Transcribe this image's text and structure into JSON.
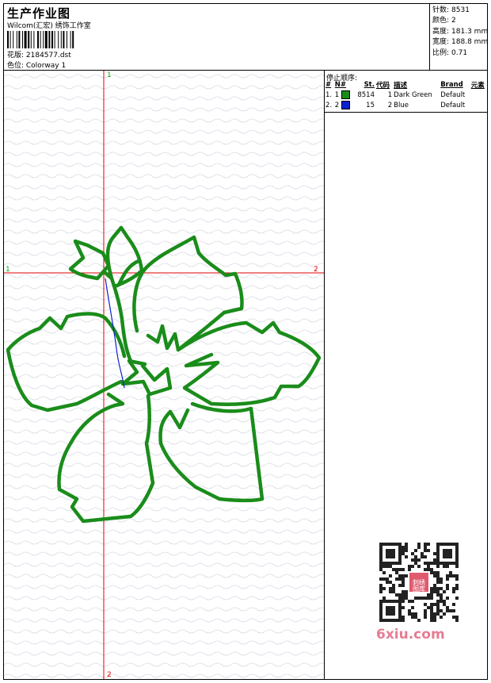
{
  "header": {
    "title": "生产作业图",
    "subtitle": "Wilcom(汇宏) 绣饰工作室",
    "design": "花版: 2184577.dst",
    "colorway": "色位: Colorway 1"
  },
  "stats": [
    {
      "label": "针数:",
      "value": "8531"
    },
    {
      "label": "颜色:",
      "value": "2"
    },
    {
      "label": "高度:",
      "value": "181.3 mm"
    },
    {
      "label": "宽度:",
      "value": "188.8 mm"
    },
    {
      "label": "比例:",
      "value": "0.71"
    }
  ],
  "stop_sequence": {
    "title": "停止顺序:",
    "columns": [
      "#",
      "N#",
      "St.",
      "代码",
      "描述",
      "Brand",
      "元素"
    ],
    "rows": [
      {
        "index": "1.",
        "n": "1",
        "color": "#1a8c1a",
        "stitches": "8514",
        "code": "1",
        "desc": "Dark Green",
        "brand": "Default",
        "element": ""
      },
      {
        "index": "2.",
        "n": "2",
        "color": "#0b1fd0",
        "stitches": "15",
        "code": "2",
        "desc": "Blue",
        "brand": "Default",
        "element": ""
      }
    ]
  },
  "axis_labels": {
    "v_top": "1",
    "h_left": "1",
    "h_right": "2",
    "v_bottom": "2"
  },
  "colors": {
    "thread_green": "#1a8c1a",
    "thread_blue": "#0b1fd0",
    "crosshair_red": "#e00000",
    "axis_label_green": "#00b000",
    "axis_label_red": "#e00000"
  },
  "watermark": "6xiu.com",
  "qr_seal_text": "刺绣图库"
}
